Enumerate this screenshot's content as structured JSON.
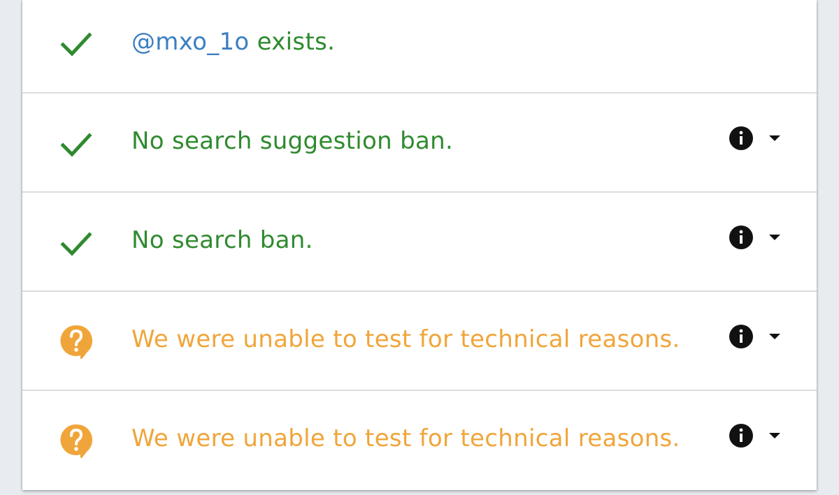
{
  "colors": {
    "ok": "#2f8a2f",
    "warn": "#f0a53a",
    "handle": "#3d7fc1"
  },
  "results": [
    {
      "status": "ok",
      "icon": "checkmark-icon",
      "handle": "@mxo_1o",
      "text": " exists."
    },
    {
      "status": "ok",
      "icon": "checkmark-icon",
      "text": "No search suggestion ban.",
      "info_icon": "info-icon",
      "toggle_icon": "caret-down-icon"
    },
    {
      "status": "ok",
      "icon": "checkmark-icon",
      "text": "No search ban.",
      "info_icon": "info-icon",
      "toggle_icon": "caret-down-icon"
    },
    {
      "status": "warn",
      "icon": "question-bubble-icon",
      "text": "We were unable to test for technical reasons.",
      "info_icon": "info-icon",
      "toggle_icon": "caret-down-icon"
    },
    {
      "status": "warn",
      "icon": "question-bubble-icon",
      "text": "We were unable to test for technical reasons.",
      "info_icon": "info-icon",
      "toggle_icon": "caret-down-icon"
    }
  ]
}
